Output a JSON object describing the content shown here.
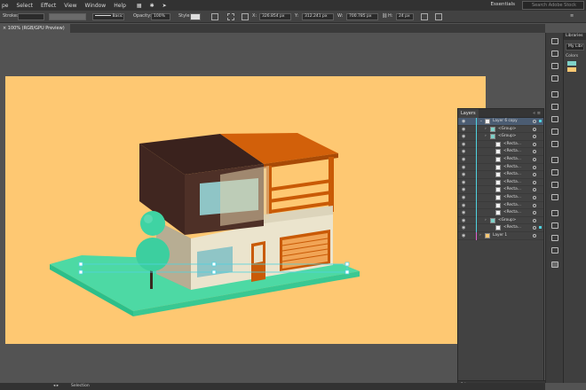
{
  "menu": [
    "pe",
    "Select",
    "Effect",
    "View",
    "Window",
    "Help"
  ],
  "workspace": "Essentials",
  "search_placeholder": "Search Adobe Stock",
  "control": {
    "stroke_label": "Stroke:",
    "brush_label": "Basic",
    "opacity_label": "Opacity:",
    "opacity_value": "100%",
    "style_label": "Style:",
    "x_value": "326.854 px",
    "y_value": "312.241 px",
    "w_value": "700.785 px",
    "h_value": "24 px"
  },
  "document_tab": "100% (RGB/GPU Preview)",
  "libraries": {
    "title": "Libraries",
    "selected": "My Libr",
    "section": "Colors",
    "swatches": [
      "#7fd1c8",
      "#fec872"
    ]
  },
  "layers": {
    "tab": "Layers",
    "count": "2 La",
    "rows": [
      {
        "name": "Layer 6 copy",
        "active": true,
        "kind": "layer",
        "indent": 0,
        "expand": "⌄"
      },
      {
        "name": "<Group>",
        "active": false,
        "kind": "group",
        "indent": 1,
        "expand": "›"
      },
      {
        "name": "<Group>",
        "active": false,
        "kind": "group",
        "indent": 1,
        "expand": "›"
      },
      {
        "name": "<Recta...",
        "active": false,
        "kind": "rect",
        "indent": 2,
        "expand": ""
      },
      {
        "name": "<Recta...",
        "active": false,
        "kind": "rect",
        "indent": 2,
        "expand": ""
      },
      {
        "name": "<Recta...",
        "active": false,
        "kind": "rect",
        "indent": 2,
        "expand": ""
      },
      {
        "name": "<Recta...",
        "active": false,
        "kind": "rect",
        "indent": 2,
        "expand": ""
      },
      {
        "name": "<Recta...",
        "active": false,
        "kind": "rect",
        "indent": 2,
        "expand": ""
      },
      {
        "name": "<Recta...",
        "active": false,
        "kind": "rect",
        "indent": 2,
        "expand": ""
      },
      {
        "name": "<Recta...",
        "active": false,
        "kind": "rect",
        "indent": 2,
        "expand": ""
      },
      {
        "name": "<Recta...",
        "active": false,
        "kind": "rect",
        "indent": 2,
        "expand": ""
      },
      {
        "name": "<Recta...",
        "active": false,
        "kind": "rect",
        "indent": 2,
        "expand": ""
      },
      {
        "name": "<Recta...",
        "active": false,
        "kind": "rect",
        "indent": 2,
        "expand": ""
      },
      {
        "name": "<Group>",
        "active": false,
        "kind": "group",
        "indent": 1,
        "expand": "›"
      },
      {
        "name": "<Recta...",
        "active": false,
        "kind": "rect",
        "indent": 2,
        "expand": "",
        "selected": true
      },
      {
        "name": "Layer 1",
        "active": false,
        "kind": "layer2",
        "indent": 0,
        "expand": "›"
      }
    ]
  },
  "status": {
    "tool": "Selection"
  },
  "colors": {
    "artboard": "#fec872",
    "ground": "#47d6a0",
    "wall_dark": "#4a2e26",
    "roof_orange": "#c95a06",
    "cream": "#ebe3cc",
    "window": "#8ec6c6",
    "tree": "#3fd3a3"
  }
}
